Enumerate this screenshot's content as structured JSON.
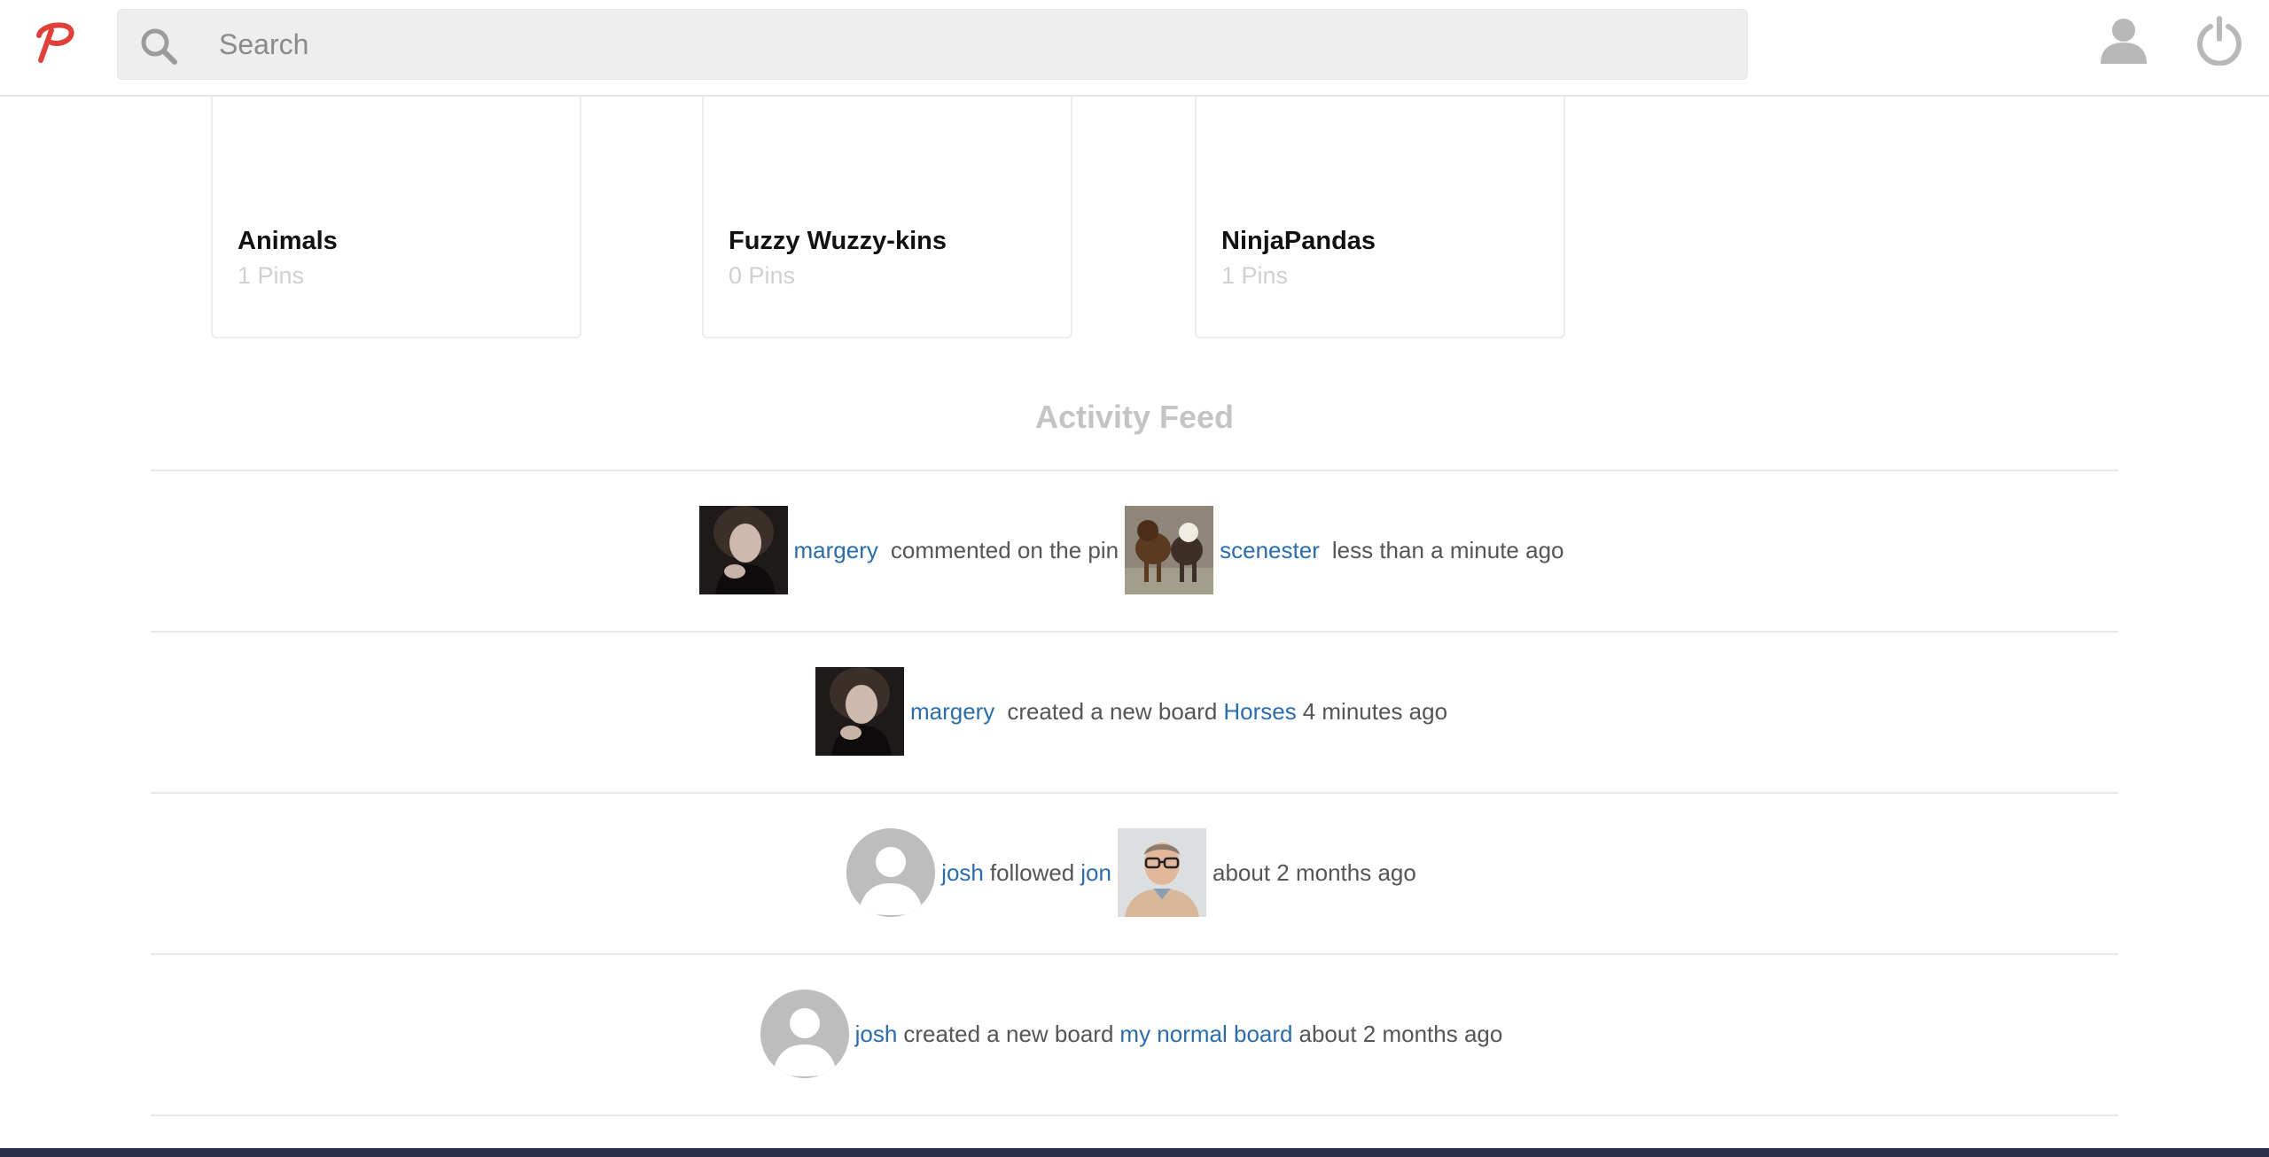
{
  "search": {
    "placeholder": "Search"
  },
  "boards": [
    {
      "name": "Animals",
      "count": "1 Pins"
    },
    {
      "name": "Fuzzy Wuzzy-kins",
      "count": "0 Pins"
    },
    {
      "name": "NinjaPandas",
      "count": "1 Pins"
    }
  ],
  "feed": {
    "title": "Activity Feed",
    "items": [
      {
        "user": "margery",
        "text1": "commented on the pin",
        "target": "scenester",
        "time": "less than a minute ago"
      },
      {
        "user": "margery",
        "text1": "created a new board",
        "target": "Horses",
        "time": "4 minutes ago"
      },
      {
        "user": "josh",
        "text1": "followed",
        "target": "jon",
        "time": "about 2 months ago"
      },
      {
        "user": "josh",
        "text1": "created a new board",
        "target": "my normal board",
        "time": "about 2 months ago"
      }
    ]
  },
  "icons": {
    "logo": "pinterest-logo-icon",
    "search": "search-icon",
    "user": "user-icon",
    "power": "power-icon"
  },
  "colors": {
    "link": "#2b6cab",
    "logo": "#e0403a",
    "muted": "#c4c4c4",
    "bottom_bar": "#2c2f48"
  }
}
